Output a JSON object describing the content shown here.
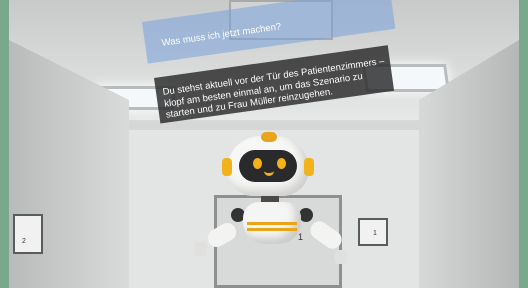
{
  "chat": {
    "question": "Was muss ich jetzt machen?",
    "answer": "Du stehst aktuell vor der Tür des Patientenzimmers – klopf am besten einmal an, um das Szenario zu starten und zu Frau Müller reinzugehen."
  },
  "environment": {
    "door_number": "1",
    "left_sign_number": "2",
    "right_sign_number": "1"
  },
  "colors": {
    "frame": "#7aa88a",
    "question_bubble": "#78a0dc",
    "answer_bubble": "#282828",
    "robot_accent": "#f2b21b"
  }
}
